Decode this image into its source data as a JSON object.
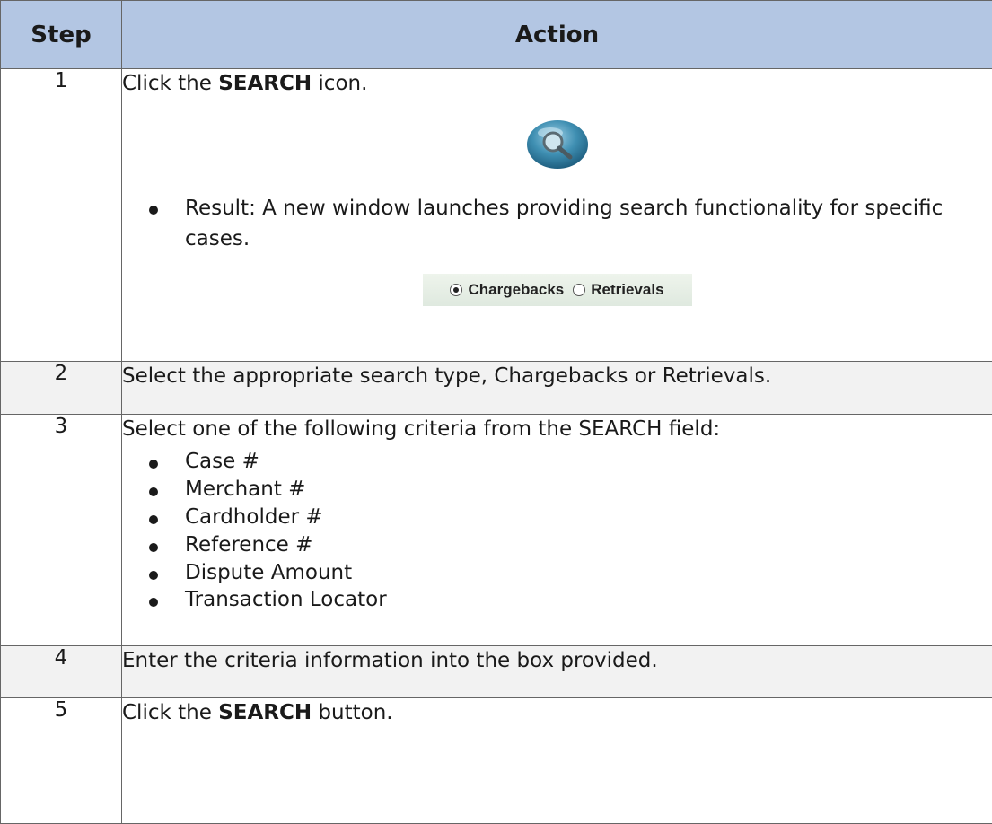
{
  "header": {
    "step": "Step",
    "action": "Action"
  },
  "rows": [
    {
      "step": "1",
      "pre": "Click the ",
      "bold": "SEARCH",
      "post": " icon.",
      "icon": "search-magnifier-icon",
      "bullet": "Result: A new window launches providing search functionality for specific cases.",
      "radios": [
        {
          "label": "Chargebacks",
          "checked": true
        },
        {
          "label": "Retrievals",
          "checked": false
        }
      ]
    },
    {
      "step": "2",
      "text": "Select the appropriate search type, Chargebacks or Retrievals."
    },
    {
      "step": "3",
      "text": "Select one of the following criteria from the SEARCH field:",
      "items": [
        "Case #",
        "Merchant #",
        "Cardholder #",
        "Reference #",
        "Dispute Amount",
        "Transaction Locator"
      ]
    },
    {
      "step": "4",
      "text": "Enter the criteria information into the box provided."
    },
    {
      "step": "5",
      "pre": "Click the ",
      "bold": "SEARCH",
      "post": " button."
    }
  ]
}
